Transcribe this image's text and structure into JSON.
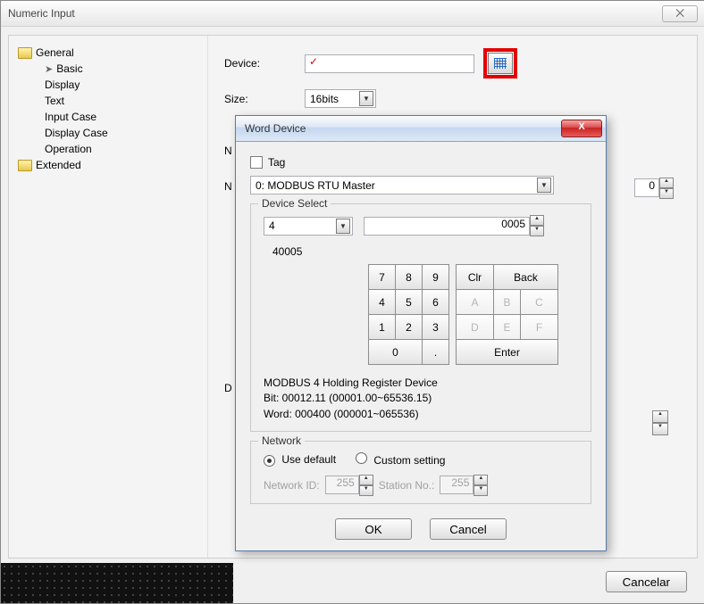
{
  "window": {
    "title": "Numeric Input",
    "close_glyph": "⨉"
  },
  "tree": {
    "general": "General",
    "basic": "Basic",
    "display": "Display",
    "text": "Text",
    "input_case": "Input Case",
    "display_case": "Display Case",
    "operation": "Operation",
    "extended": "Extended"
  },
  "form": {
    "device_label": "Device:",
    "device_value": "✓",
    "size_label": "Size:",
    "size_value": "16bits",
    "hidden_n1": "N",
    "hidden_n2": "N",
    "hidden_d": "D",
    "spinner_zero": "0",
    "cancel": "Cancelar"
  },
  "dialog": {
    "title": "Word Device",
    "close_glyph": "X",
    "tag_label": "Tag",
    "master_value": "0: MODBUS RTU Master",
    "ds_title": "Device Select",
    "register": "4",
    "address": "0005",
    "result": "40005",
    "kp": {
      "k7": "7",
      "k8": "8",
      "k9": "9",
      "clr": "Clr",
      "back": "Back",
      "k4": "4",
      "k5": "5",
      "k6": "6",
      "ka": "A",
      "kb": "B",
      "kc": "C",
      "k1": "1",
      "k2": "2",
      "k3": "3",
      "kd": "D",
      "ke": "E",
      "kf": "F",
      "k0": "0",
      "dot": ".",
      "enter": "Enter"
    },
    "info1": "MODBUS 4 Holding Register Device",
    "info2": "Bit: 00012.11 (00001.00~65536.15)",
    "info3": "Word: 000400 (000001~065536)",
    "net_title": "Network",
    "use_default": "Use default",
    "custom": "Custom setting",
    "net_id_label": "Network ID:",
    "net_id": "255",
    "station_label": "Station No.:",
    "station": "255",
    "ok": "OK",
    "cancel": "Cancel"
  }
}
